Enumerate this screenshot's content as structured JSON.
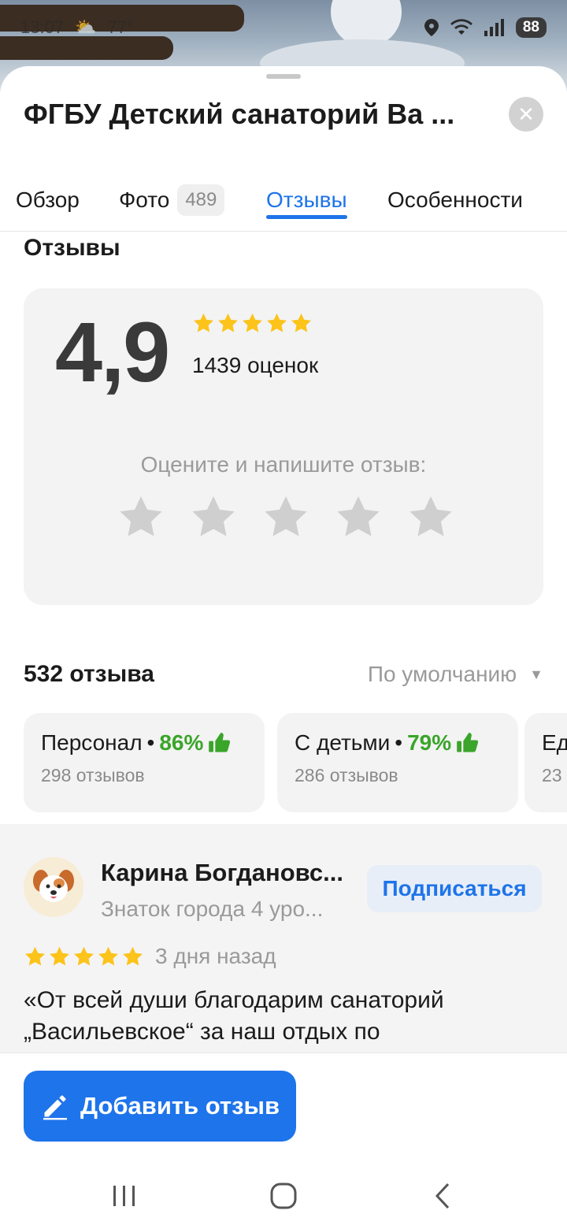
{
  "status_bar": {
    "time": "13:07",
    "temperature": "77°",
    "battery": "88"
  },
  "header": {
    "title": "ФГБУ Детский санаторий Ва ...",
    "close_icon": "close-icon"
  },
  "tabs": [
    {
      "label": "Обзор",
      "active": false
    },
    {
      "label": "Фото",
      "count": "489",
      "active": false
    },
    {
      "label": "Отзывы",
      "active": true
    },
    {
      "label": "Особенности",
      "active": false
    }
  ],
  "section": {
    "title": "Отзывы"
  },
  "rating": {
    "value": "4,9",
    "stars_filled": 5,
    "count_text": "1439 оценок",
    "prompt": "Оцените и напишите отзыв:",
    "input_stars": 5
  },
  "reviews": {
    "count_text": "532 отзыва",
    "sort_label": "По умолчанию"
  },
  "aspects": [
    {
      "name": "Персонал",
      "percent": "86%",
      "reviews": "298 отзывов"
    },
    {
      "name": "С детьми",
      "percent": "79%",
      "reviews": "286 отзывов"
    },
    {
      "name": "Ед",
      "percent": "",
      "reviews": "23"
    }
  ],
  "review": {
    "author": "Карина Богдановс...",
    "level": "Знаток города 4 уро...",
    "subscribe_label": "Подписаться",
    "stars": 5,
    "date": "3 дня назад",
    "text_line1": "«От всей души благодарим санаторий",
    "text_line2": "„Васильевское“ за наш отдых по"
  },
  "actions": {
    "add_review_label": "Добавить отзыв"
  },
  "colors": {
    "accent": "#1e74ea",
    "star": "#fcc31a",
    "positive": "#3aa52a",
    "card_bg": "#f3f3f3"
  }
}
